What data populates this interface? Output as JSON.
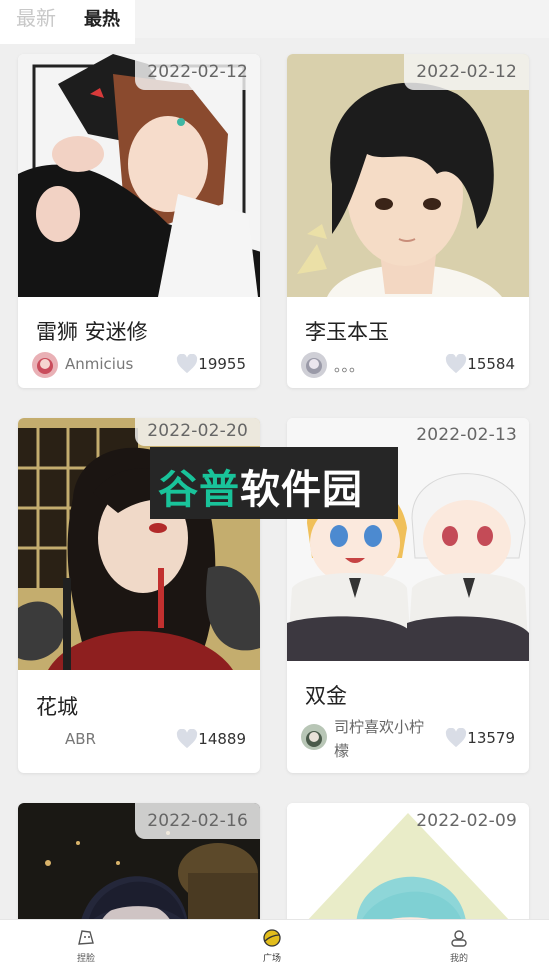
{
  "tabs": {
    "latest": "最新",
    "hot": "最热"
  },
  "cards": [
    {
      "date": "2022-02-12",
      "title": "雷狮 安迷修",
      "author": "Anmicius",
      "likes": "19955"
    },
    {
      "date": "2022-02-12",
      "title": "李玉本玉",
      "author": "。。。",
      "likes": "15584"
    },
    {
      "date": "2022-02-20",
      "title": "花城",
      "author": "ABR",
      "likes": "14889"
    },
    {
      "date": "2022-02-13",
      "title": "双金",
      "author_line1": "司柠喜欢小柠",
      "author_line2": "檬",
      "likes": "13579"
    },
    {
      "date": "2022-02-16"
    },
    {
      "date": "2022-02-09"
    }
  ],
  "watermark": {
    "part1": "谷普",
    "part2": "软件园"
  },
  "nav": {
    "explore": "捏脸",
    "square": "广场",
    "mine": "我的"
  },
  "colors": {
    "accent": "#d8b100",
    "heart": "#d9dde6"
  }
}
